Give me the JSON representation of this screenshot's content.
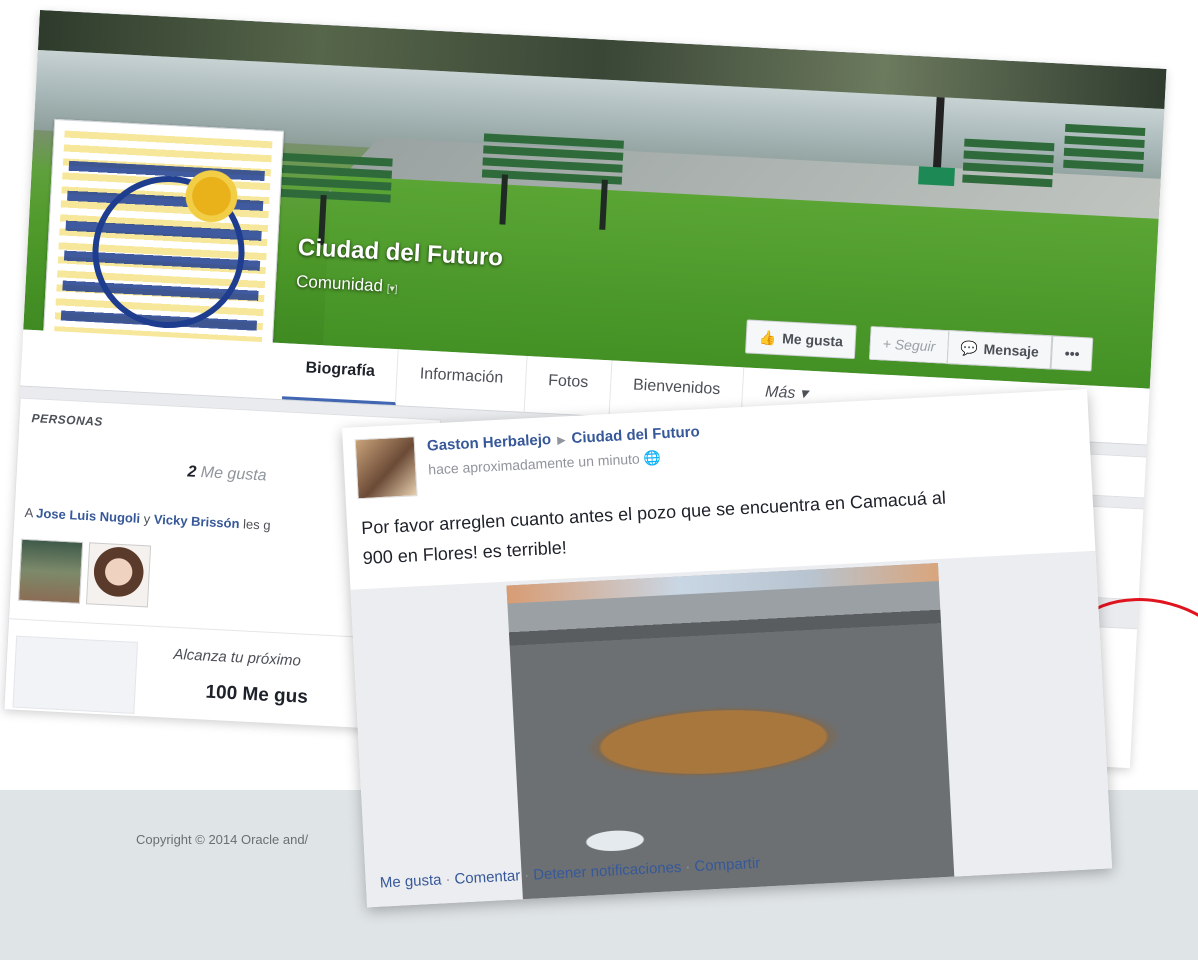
{
  "page": {
    "name": "Ciudad del Futuro",
    "category": "Comunidad",
    "category_caret": "[▾]",
    "actions": {
      "like": "Me gusta",
      "follow": "+ Seguir",
      "message": "Mensaje",
      "more": "•••"
    },
    "tabs": [
      "Biografía",
      "Información",
      "Fotos",
      "Bienvenidos",
      "Más ▾"
    ]
  },
  "people": {
    "section_title": "PERSONAS",
    "likes_count": "2",
    "likes_label": "Me gusta",
    "liked_by_prefix": "A",
    "liked_by_1": "Jose Luis Nugoli",
    "liked_by_and": "y",
    "liked_by_2": "Vicky Brissón",
    "liked_by_suffix": "les g",
    "goal_text": "Alcanza tu próximo",
    "goal_value": "100 Me gus"
  },
  "post": {
    "author": "Gaston Herbalejo",
    "target": "Ciudad del Futuro",
    "time": "hace aproximadamente un minuto",
    "text_line1": "Por favor arreglen cuanto antes el pozo que se encuentra en Camacuá al",
    "text_line2": "900 en Flores! es terrible!",
    "actions": [
      "Me gusta",
      "Comentar",
      "Detener notificaciones",
      "Compartir"
    ]
  },
  "footer": {
    "copyright": "Copyright © 2014 Oracle and/"
  },
  "colors": {
    "fb_blue": "#365899",
    "accent_red": "#e0141e"
  }
}
